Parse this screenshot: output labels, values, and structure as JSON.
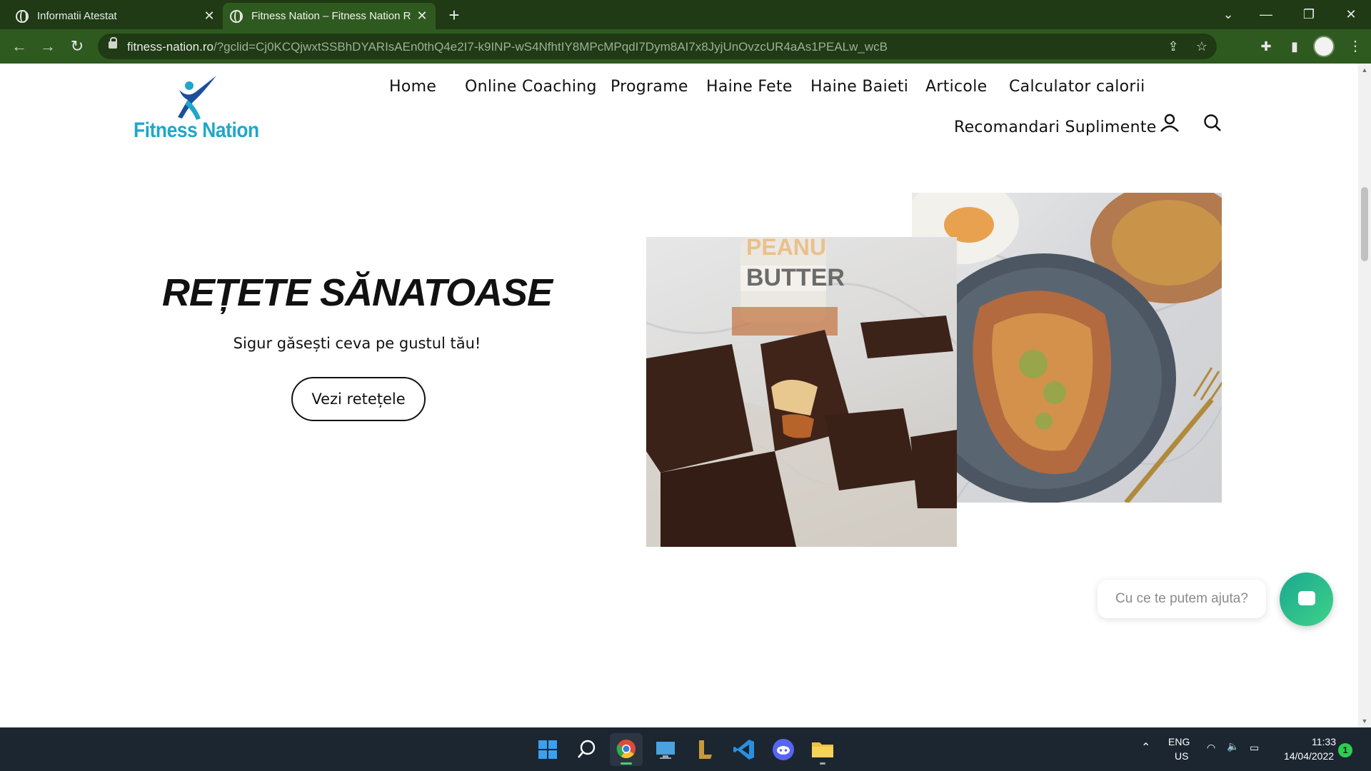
{
  "browser": {
    "tabs": [
      {
        "title": "Informatii Atestat",
        "active": false
      },
      {
        "title": "Fitness Nation – Fitness Nation R",
        "active": true
      }
    ],
    "new_tab_icon": "plus-icon",
    "url_domain": "fitness-nation.ro",
    "url_rest": "/?gclid=Cj0KCQjwxtSSBhDYARIsAEn0thQ4e2I7-k9INP-wS4NfhtIY8MPcMPqdI7Dym8AI7x8JyjUnOvzcUR4aAs1PEALw_wcB"
  },
  "site": {
    "logo_text": "Fitness Nation",
    "nav": [
      "Home",
      "Online Coaching",
      "Programe",
      "Haine Fete",
      "Haine Baieti",
      "Articole",
      "Calculator calorii",
      "Recomandari Suplimente"
    ],
    "account_icon": "account-icon",
    "search_icon": "search-icon"
  },
  "hero": {
    "title": "REȚETE SĂNATOASE",
    "subtitle": "Sigur găsești ceva pe gustul tău!",
    "button": "Vezi retețele"
  },
  "chat": {
    "prompt": "Cu ce te putem ajuta?"
  },
  "taskbar": {
    "language": "ENG",
    "region": "US",
    "time": "11:33",
    "date": "14/04/2022",
    "notifications": "1"
  },
  "colors": {
    "titlebar": "#1f3a14",
    "toolbar": "#2f5a1f",
    "logo_blue": "#1fa7c9",
    "chat_green": "#2ec18a",
    "taskbar": "#1b2631"
  }
}
